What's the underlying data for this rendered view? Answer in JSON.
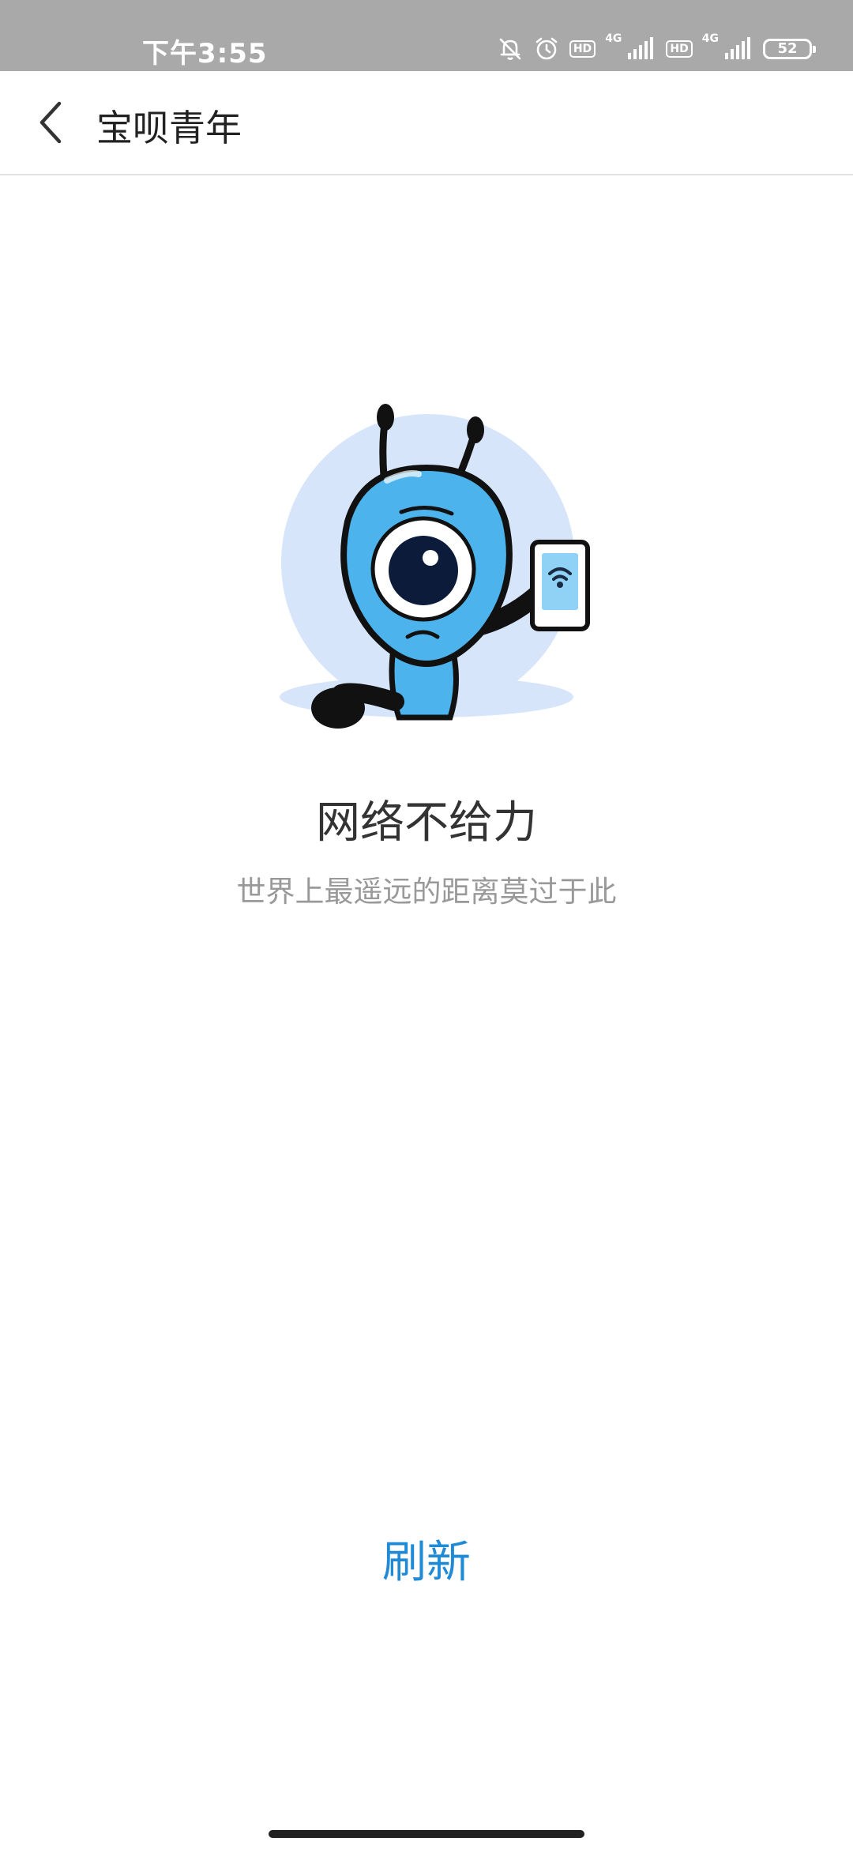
{
  "status_bar": {
    "time": "下午3:55",
    "hd1": "HD",
    "sig1": "4G",
    "hd2": "HD",
    "sig2": "4G",
    "battery": "52",
    "icons": [
      "mute-bell-icon",
      "alarm-icon",
      "signal-icon",
      "signal-icon",
      "battery-icon"
    ]
  },
  "header": {
    "back_icon": "chevron-left-icon",
    "title": "宝呗青年"
  },
  "error": {
    "illustration": "mascot-with-phone-wifi",
    "title": "网络不给力",
    "subtitle": "世界上最遥远的距离莫过于此"
  },
  "actions": {
    "refresh_label": "刷新"
  },
  "colors": {
    "status_bar_bg": "#a9a9a9",
    "accent": "#1f8ad6",
    "title_text": "#333333",
    "subtitle_text": "#999999",
    "mascot_blue": "#4db3ec",
    "halo": "#d7e5fb"
  }
}
